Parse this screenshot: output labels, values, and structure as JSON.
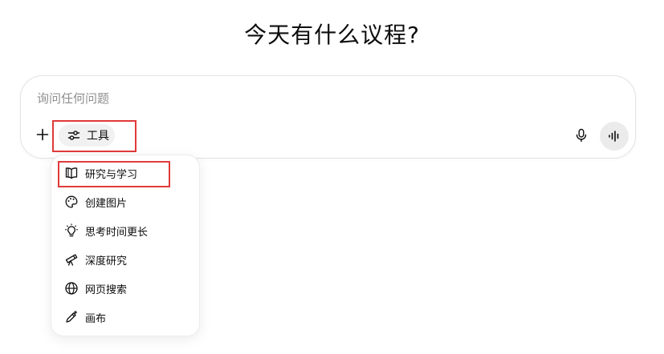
{
  "heading": "今天有什么议程?",
  "composer": {
    "placeholder": "询问任何问题",
    "tools_label": "工具"
  },
  "tools_menu": {
    "items": [
      {
        "label": "研究与学习",
        "icon": "book-open-icon"
      },
      {
        "label": "创建图片",
        "icon": "palette-icon"
      },
      {
        "label": "思考时间更长",
        "icon": "lightbulb-icon"
      },
      {
        "label": "深度研究",
        "icon": "telescope-icon"
      },
      {
        "label": "网页搜索",
        "icon": "globe-icon"
      },
      {
        "label": "画布",
        "icon": "pen-sparkle-icon"
      }
    ]
  },
  "colors": {
    "highlight": "#e03a3a",
    "text": "#0d0d0d",
    "placeholder": "#8f8f8f"
  }
}
